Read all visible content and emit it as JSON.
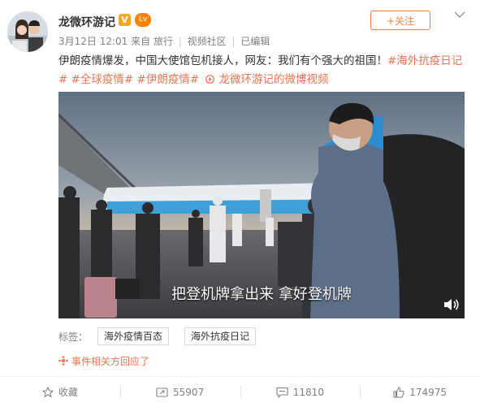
{
  "user": {
    "name": "龙微环游记",
    "v_badge": "V",
    "level_badge": "Lv"
  },
  "post_meta": {
    "date": "3月12日 12:01",
    "from": "来自 旅行",
    "community": "视频社区",
    "edited": "已编辑"
  },
  "follow_button": {
    "label": "+关注"
  },
  "post": {
    "text": "伊朗疫情爆发，中国大使馆包机接人，网友：我们有个强大的祖国！",
    "hashtags": [
      "#海外抗疫日记#",
      "#全球疫情#",
      "#伊朗疫情#"
    ],
    "video_link": "龙微环游记的微博视频"
  },
  "video": {
    "subtitle": "把登机牌拿出来 拿好登机牌"
  },
  "tags": {
    "label": "标签：",
    "items": [
      "海外疫情百态",
      "海外抗疫日记"
    ]
  },
  "responded": "事件相关方回应了",
  "actions": {
    "collect": "收藏",
    "forward": "55907",
    "comment": "11810",
    "like": "174975"
  }
}
